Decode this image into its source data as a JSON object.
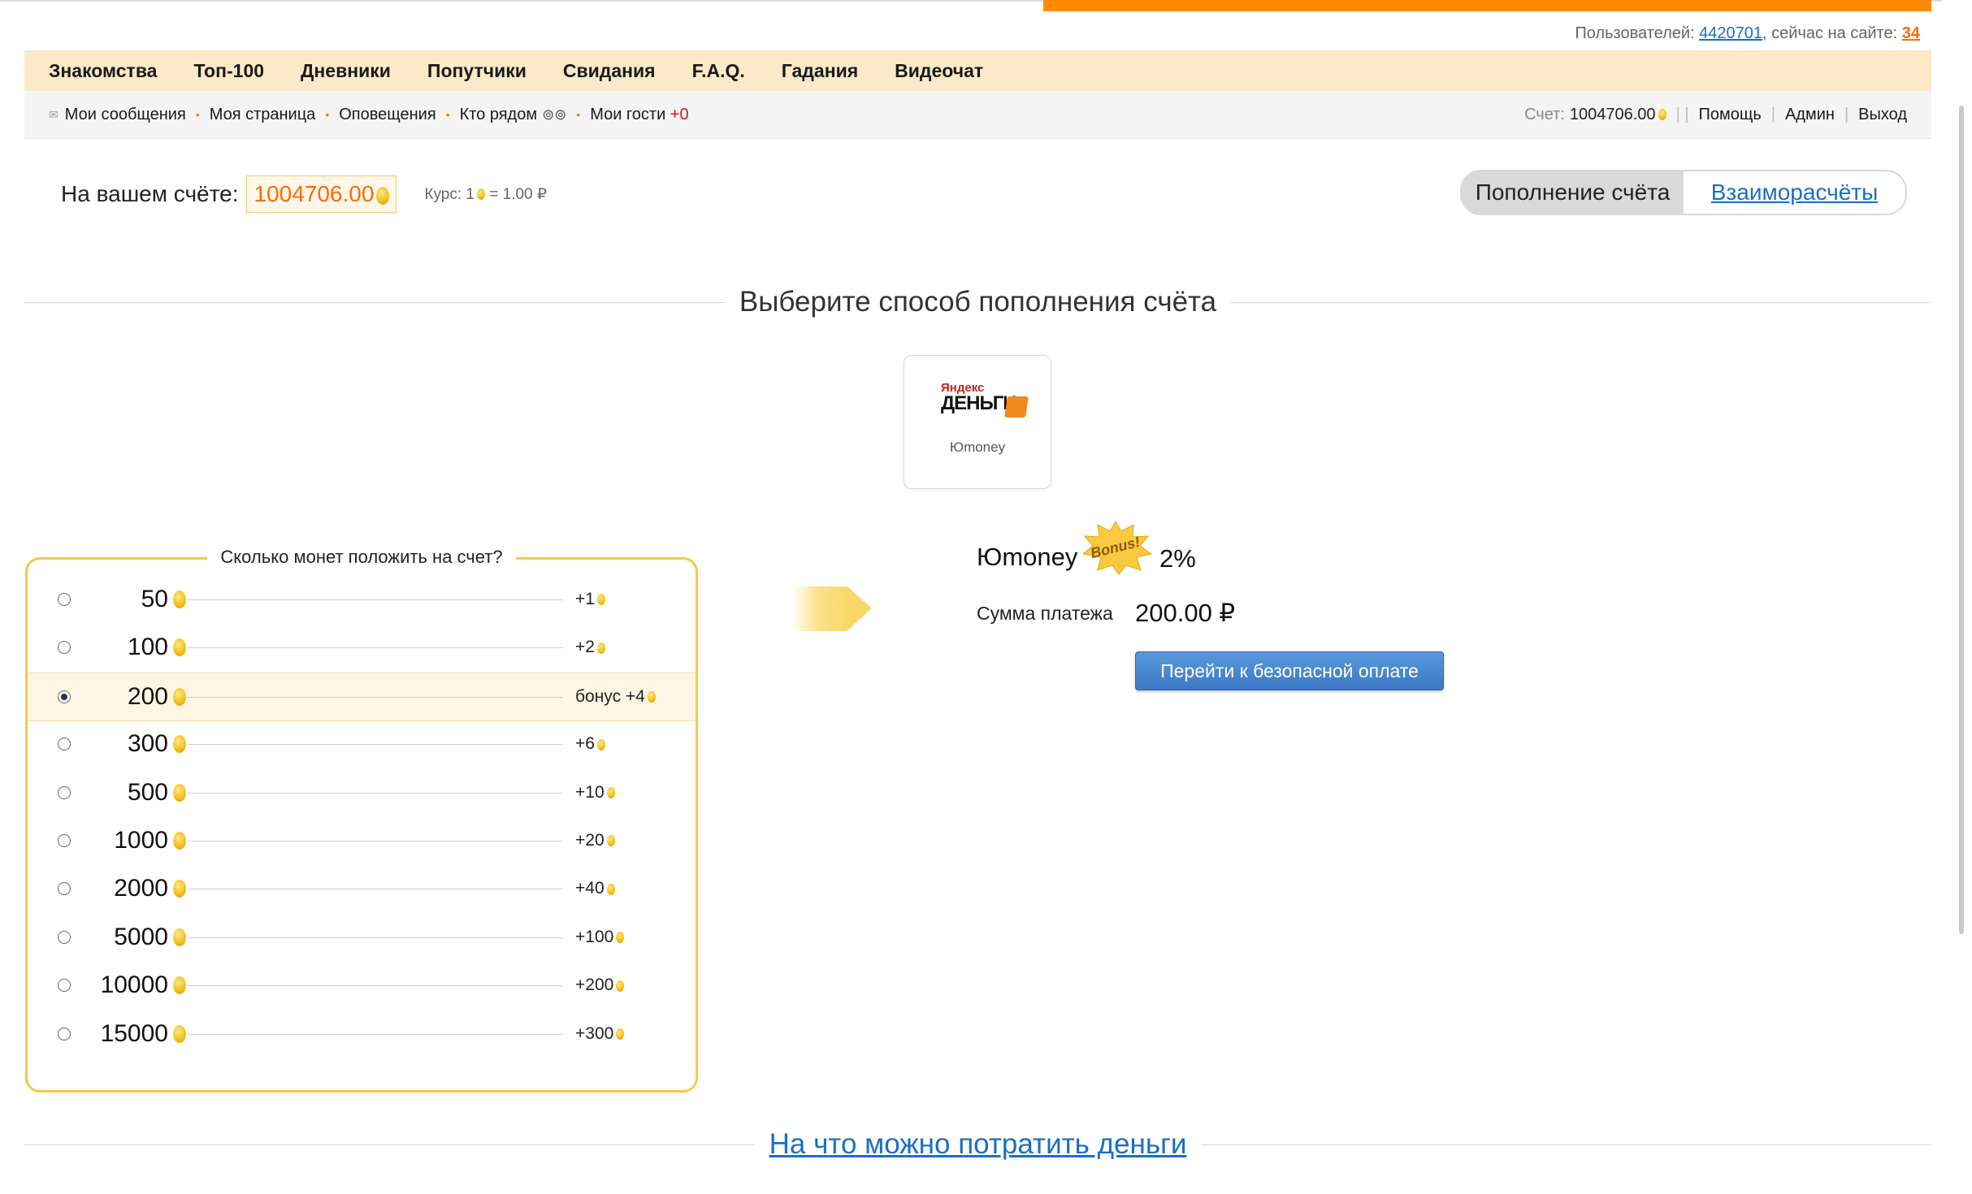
{
  "header": {
    "users_label": "Пользователей:",
    "users_count": "4420701",
    "online_label": ", сейчас на сайте:",
    "online_count": "34"
  },
  "main_nav": [
    {
      "label": "Знакомства"
    },
    {
      "label": "Топ-100"
    },
    {
      "label": "Дневники"
    },
    {
      "label": "Попутчики"
    },
    {
      "label": "Свидания"
    },
    {
      "label": "F.A.Q."
    },
    {
      "label": "Гадания"
    },
    {
      "label": "Видеочат"
    }
  ],
  "sub_nav": {
    "messages": "Мои сообщения",
    "my_page": "Моя страница",
    "notifications": "Оповещения",
    "nearby": "Кто рядом",
    "guests": "Мои гости",
    "guests_count": "+0",
    "account_label": "Счет:",
    "account_value": "1004706.00",
    "help": "Помощь",
    "admin": "Админ",
    "logout": "Выход"
  },
  "balance": {
    "label": "На вашем счёте:",
    "value": "1004706.00",
    "rate_prefix": "Курс: 1",
    "rate_suffix": "= 1.00 ₽"
  },
  "tabs": [
    {
      "label": "Пополнение счёта",
      "active": true
    },
    {
      "label": "Взаиморасчёты",
      "active": false
    }
  ],
  "section_title": "Выберите способ пополнения счёта",
  "method": {
    "logo_top": "Яндекс",
    "logo_bottom": "ДЕНЬГИ",
    "name": "Юmoney"
  },
  "coins": {
    "legend": "Сколько монет положить на счет?",
    "rows": [
      {
        "amount": "50",
        "bonus": "+1",
        "selected": false
      },
      {
        "amount": "100",
        "bonus": "+2",
        "selected": false
      },
      {
        "amount": "200",
        "bonus": "бонус +4",
        "selected": true
      },
      {
        "amount": "300",
        "bonus": "+6",
        "selected": false
      },
      {
        "amount": "500",
        "bonus": "+10",
        "selected": false
      },
      {
        "amount": "1000",
        "bonus": "+20",
        "selected": false
      },
      {
        "amount": "2000",
        "bonus": "+40",
        "selected": false
      },
      {
        "amount": "5000",
        "bonus": "+100",
        "selected": false
      },
      {
        "amount": "10000",
        "bonus": "+200",
        "selected": false
      },
      {
        "amount": "15000",
        "bonus": "+300",
        "selected": false
      }
    ]
  },
  "payment": {
    "title": "Юmoney",
    "badge": "Bonus!",
    "percent": "2%",
    "sum_label": "Сумма платежа",
    "sum_value": "200.00 ₽",
    "button": "Перейти к безопасной оплате"
  },
  "footer_link": "На что можно потратить деньги",
  "colors": {
    "accent_orange": "#ff8c00",
    "nav_background": "#fce9c7",
    "link_blue": "#1a6fc5",
    "frame_yellow": "#f8c84a",
    "button_blue": "#4a88d2"
  }
}
